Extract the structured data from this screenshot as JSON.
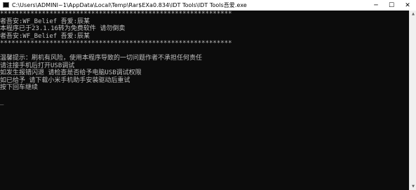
{
  "window": {
    "title": "C:\\Users\\ADMINI~1\\AppData\\Local\\Temp\\Rar$EXa0.834\\IDT Tools\\IDT Tools吾爱.exe",
    "controls": {
      "minimize": "─",
      "maximize": "☐",
      "close": "✕"
    }
  },
  "console": {
    "lines": [
      "*************************************************************",
      "者吾安:WF_Belief 吾爱:辰某",
      "本程序已于23.1.16转为免费软件 请勿倒卖",
      "者吾安:WF_Belief 吾爱:辰某",
      "*************************************************************",
      "",
      "温馨提示：刷机有风险，使用本程序导致的一切问题作者不承担任何责任",
      "请注接手机后打开USB调试",
      "如发生报错闪退 请检查是否给予电脑USB调试权限",
      "如已给予 请下载小米手机助手安装驱动后重试",
      "按下回车继续",
      "",
      "_"
    ]
  },
  "scrollbar": {
    "up": "▲",
    "down": "▼"
  }
}
